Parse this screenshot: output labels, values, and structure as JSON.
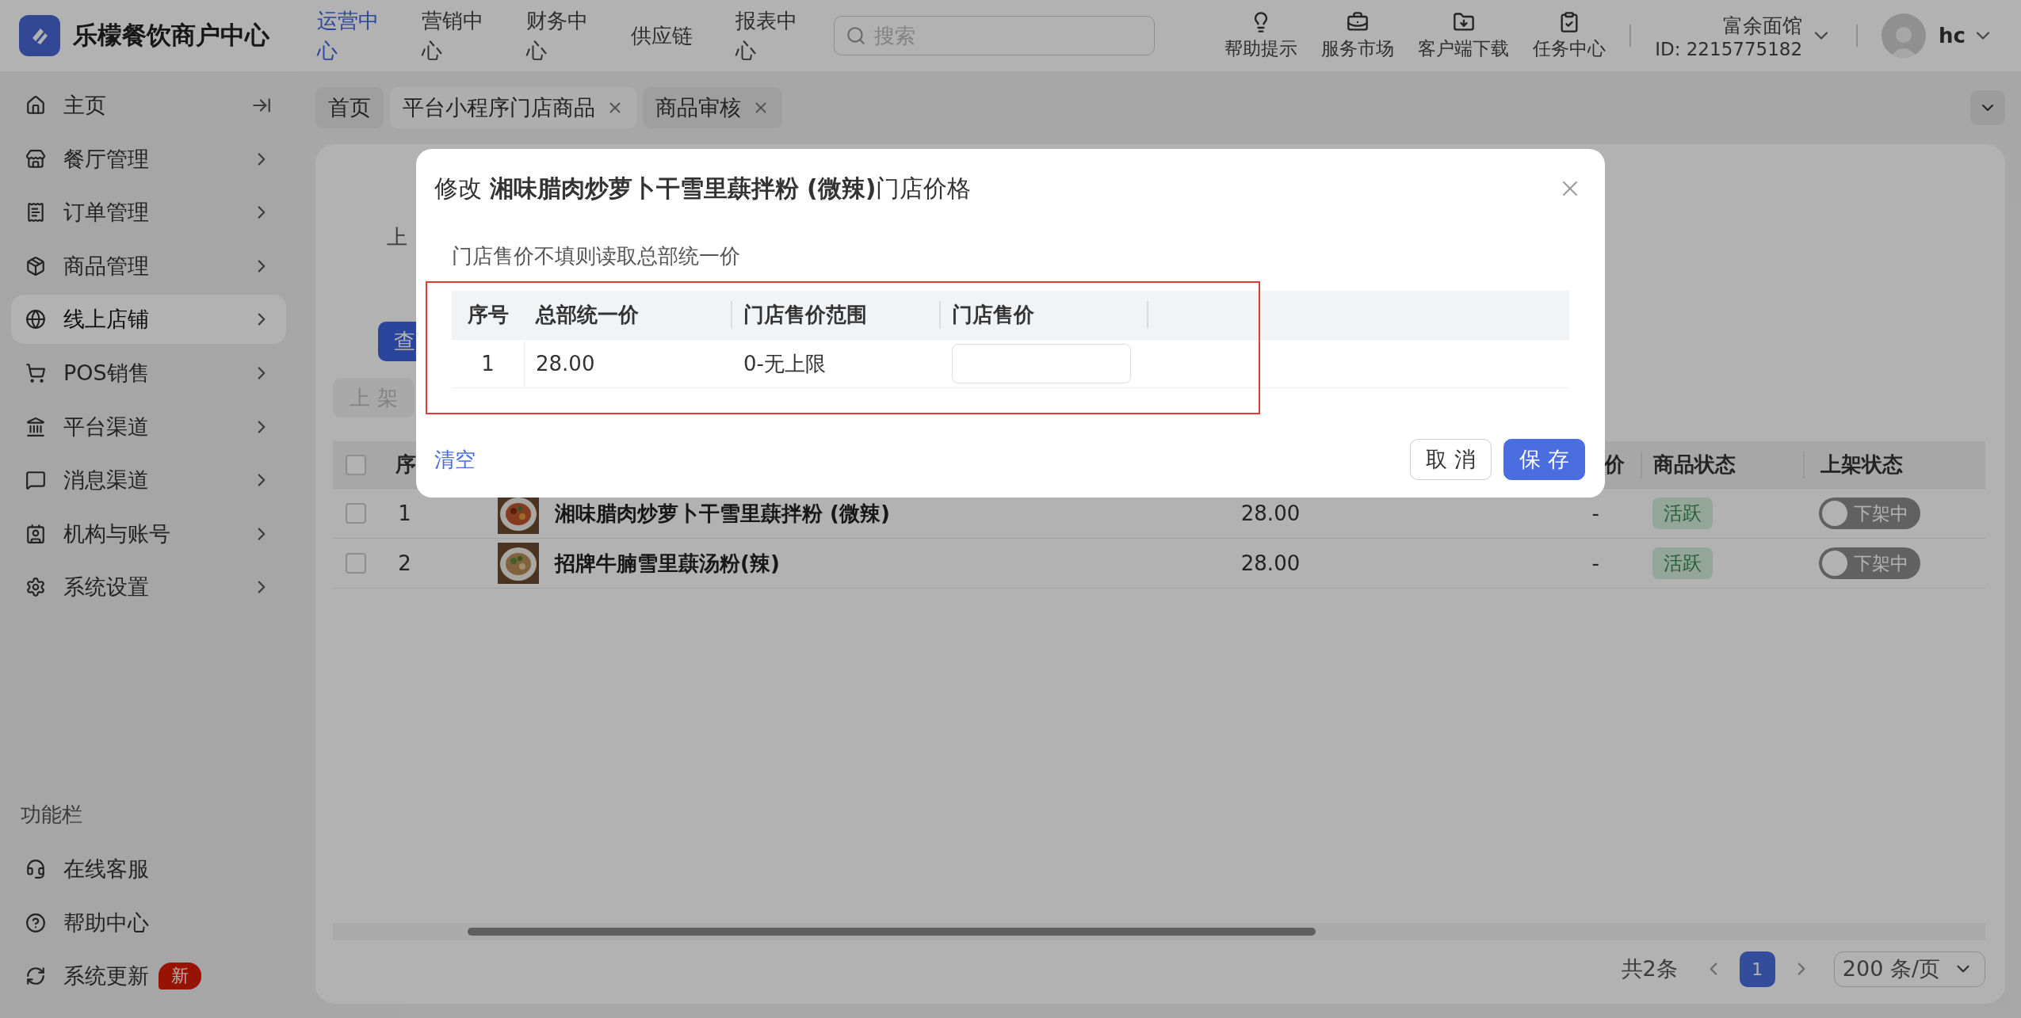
{
  "brand": {
    "name": "乐檬餐饮商户中心"
  },
  "top_nav": [
    {
      "label": "运营中心",
      "selected": true
    },
    {
      "label": "营销中心",
      "selected": false
    },
    {
      "label": "财务中心",
      "selected": false
    },
    {
      "label": "供应链",
      "selected": false
    },
    {
      "label": "报表中心",
      "selected": false
    }
  ],
  "search": {
    "placeholder": "搜索"
  },
  "tools": [
    {
      "kind": "tips",
      "label": "帮助提示"
    },
    {
      "kind": "market",
      "label": "服务市场"
    },
    {
      "kind": "download",
      "label": "客户端下载"
    },
    {
      "kind": "tasks",
      "label": "任务中心"
    }
  ],
  "store": {
    "name": "富余面馆",
    "id": "ID: 2215775182"
  },
  "user": {
    "name": "hc"
  },
  "sidebar": {
    "items": [
      {
        "kind": "home",
        "label": "主页",
        "selected": false
      },
      {
        "kind": "store",
        "label": "餐厅管理",
        "selected": false
      },
      {
        "kind": "order",
        "label": "订单管理",
        "selected": false
      },
      {
        "kind": "goods",
        "label": "商品管理",
        "selected": false
      },
      {
        "kind": "online",
        "label": "线上店铺",
        "selected": true
      },
      {
        "kind": "pos",
        "label": "POS销售",
        "selected": false
      },
      {
        "kind": "platform",
        "label": "平台渠道",
        "selected": false
      },
      {
        "kind": "message",
        "label": "消息渠道",
        "selected": false
      },
      {
        "kind": "org",
        "label": "机构与账号",
        "selected": false
      },
      {
        "kind": "settings",
        "label": "系统设置",
        "selected": false
      }
    ],
    "footer_title": "功能栏",
    "footer_items": [
      {
        "kind": "service",
        "label": "在线客服"
      },
      {
        "kind": "help",
        "label": "帮助中心"
      },
      {
        "kind": "update",
        "label": "系统更新",
        "badge": "新"
      }
    ]
  },
  "page_tabs": [
    {
      "label": "首页",
      "closable": false,
      "selected": false
    },
    {
      "label": "平台小程序门店商品",
      "closable": true,
      "selected": true
    },
    {
      "label": "商品审核",
      "closable": true,
      "selected": false
    }
  ],
  "filter": {
    "label": "上",
    "query_button": "查"
  },
  "actions": [
    {
      "label": "上 架",
      "disabled": true
    }
  ],
  "table": {
    "all_checked": false,
    "columns": [
      "序",
      "价",
      "商品状态",
      "上架状态"
    ],
    "rows": [
      {
        "checked": false,
        "index": "1",
        "name": "湘味腊肉炒萝卜干雪里蕻拌粉 (微辣)",
        "price": "28.00",
        "column_5": "-",
        "status": "活跃",
        "listed": false,
        "listed_label": "下架中"
      },
      {
        "checked": false,
        "index": "2",
        "name": "招牌牛腩雪里蕻汤粉(辣)",
        "price": "28.00",
        "column_5": "-",
        "status": "活跃",
        "listed": false,
        "listed_label": "下架中"
      }
    ]
  },
  "pagination": {
    "total": "共2条",
    "current": "1",
    "page_size": "200 条/页"
  },
  "dialog": {
    "title": "修改 **湘味腊肉炒萝卜干雪里蕻拌粉 (微辣)**门店价格",
    "hint": "门店售价不填则读取总部统一价",
    "columns": [
      "序号",
      "总部统一价",
      "门店售价范围",
      "门店售价"
    ],
    "rows": [
      {
        "index": "1",
        "hq_price": "28.00",
        "range": "0-无上限"
      }
    ],
    "clear": "清空",
    "cancel": "取 消",
    "save": "保 存"
  }
}
